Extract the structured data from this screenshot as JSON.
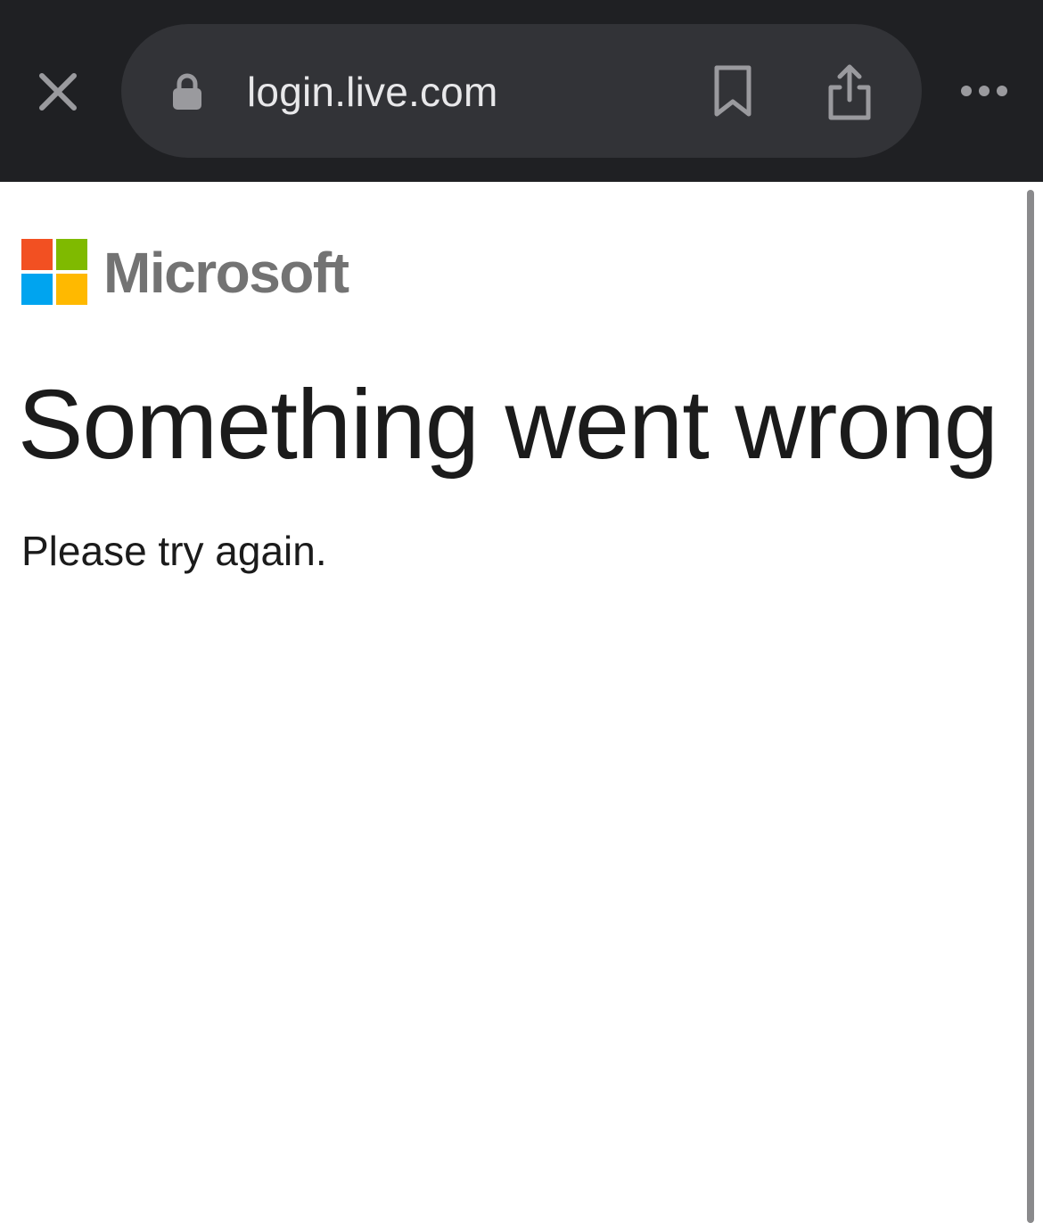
{
  "browser": {
    "url": "login.live.com",
    "icons": {
      "close": "close-icon",
      "lock": "lock-icon",
      "bookmark": "bookmark-icon",
      "share": "share-icon",
      "more": "more-icon"
    },
    "colors": {
      "toolbar_bg": "#1f2023",
      "pill_bg": "#323337",
      "icon": "#9a9a9e"
    }
  },
  "logo": {
    "wordmark": "Microsoft",
    "colors": {
      "red": "#f25022",
      "green": "#7fba00",
      "blue": "#00a4ef",
      "yellow": "#ffb900",
      "wordmark": "#737373"
    }
  },
  "error": {
    "title": "Something went wrong",
    "description": "Please try again."
  }
}
